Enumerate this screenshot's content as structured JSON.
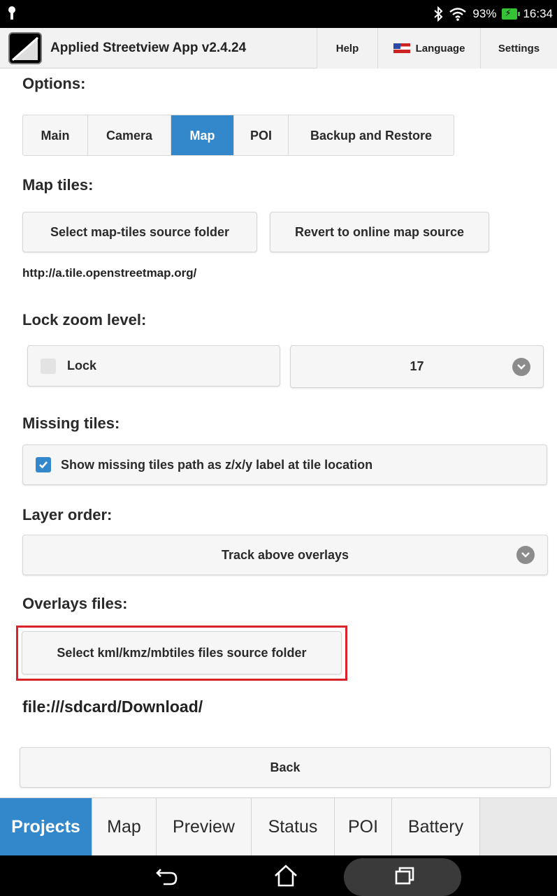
{
  "status_bar": {
    "battery_percent": "93%",
    "time": "16:34",
    "icons": [
      "android-icon",
      "bluetooth-icon",
      "wifi-icon",
      "battery-charging-icon"
    ]
  },
  "app": {
    "title": "Applied Streetview App v2.4.24",
    "help_label": "Help",
    "language_label": "Language",
    "settings_label": "Settings"
  },
  "options": {
    "heading": "Options:",
    "tabs": [
      {
        "label": "Main",
        "active": false
      },
      {
        "label": "Camera",
        "active": false
      },
      {
        "label": "Map",
        "active": true
      },
      {
        "label": "POI",
        "active": false
      },
      {
        "label": "Backup and Restore",
        "active": false
      }
    ]
  },
  "map_tiles": {
    "heading": "Map tiles:",
    "select_folder_label": "Select map-tiles source folder",
    "revert_label": "Revert to online map source",
    "source_url": "http://a.tile.openstreetmap.org/"
  },
  "lock_zoom": {
    "heading": "Lock zoom level:",
    "lock_label": "Lock",
    "lock_checked": false,
    "zoom_value": "17"
  },
  "missing_tiles": {
    "heading": "Missing tiles:",
    "checkbox_label": "Show missing tiles path as z/x/y label at tile location",
    "checked": true
  },
  "layer_order": {
    "heading": "Layer order:",
    "selected": "Track above overlays"
  },
  "overlays": {
    "heading": "Overlays files:",
    "select_label": "Select kml/kmz/mbtiles files source folder",
    "path": "file:///sdcard/Download/"
  },
  "back_label": "Back",
  "bottom_nav": [
    {
      "label": "Projects",
      "active": true
    },
    {
      "label": "Map",
      "active": false
    },
    {
      "label": "Preview",
      "active": false
    },
    {
      "label": "Status",
      "active": false
    },
    {
      "label": "POI",
      "active": false
    },
    {
      "label": "Battery",
      "active": false
    }
  ],
  "colors": {
    "accent": "#3388cc",
    "highlight_box": "#d8232a"
  }
}
